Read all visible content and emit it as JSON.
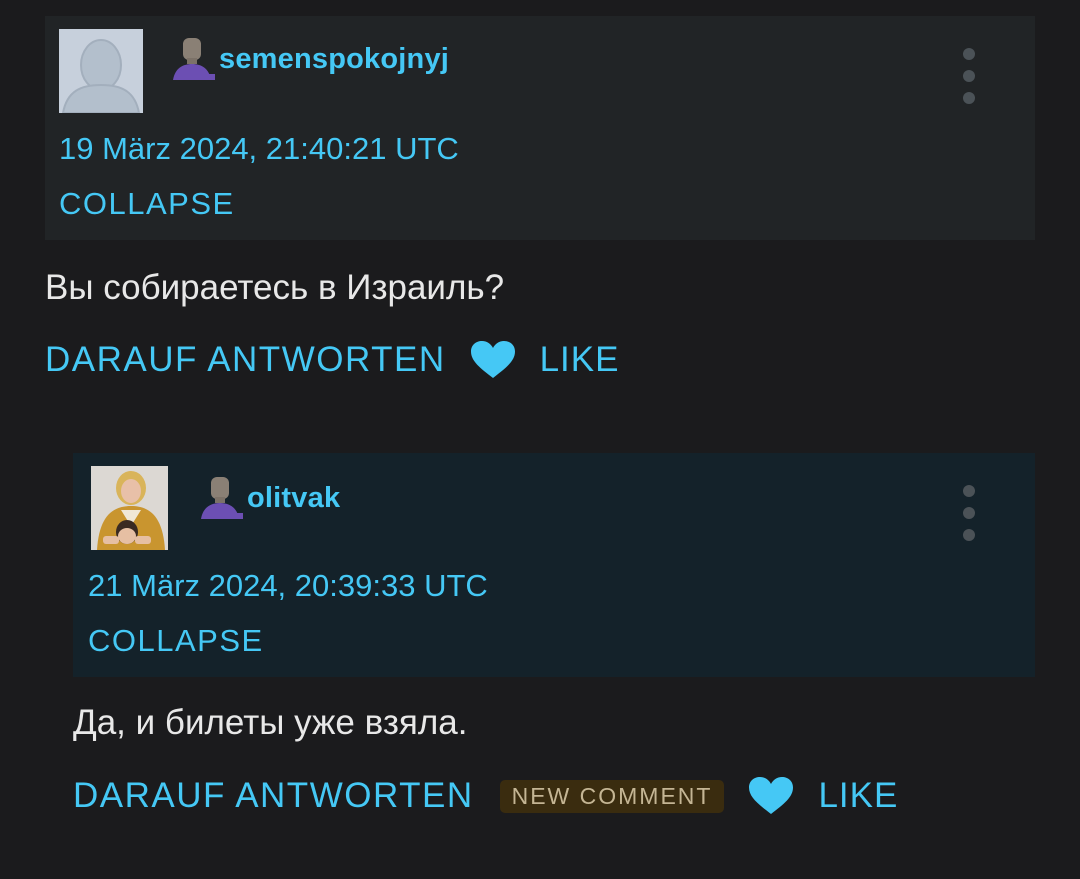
{
  "comments": [
    {
      "username": "semenspokojnyj",
      "timestamp": "19 März 2024, 21:40:21 UTC",
      "collapse_label": "COLLAPSE",
      "text": "Вы собираетесь в Израиль?",
      "reply_label": "DARAUF ANTWORTEN",
      "like_label": "LIKE"
    },
    {
      "username": "olitvak",
      "timestamp": "21 März 2024, 20:39:33 UTC",
      "collapse_label": "COLLAPSE",
      "text": "Да, и билеты уже взяла.",
      "reply_label": "DARAUF ANTWORTEN",
      "badge": "NEW COMMENT",
      "like_label": "LIKE"
    }
  ],
  "colors": {
    "background": "#1b1b1d",
    "header_primary": "#212426",
    "header_reply": "#14222a",
    "accent": "#45c8f5",
    "body_text": "#e8e8e8",
    "badge_bg": "#3a2c0f",
    "badge_text": "#c4b594"
  },
  "icons": {
    "user": "user-silhouette-icon",
    "menu": "more-vertical-icon",
    "like": "heart-icon"
  }
}
